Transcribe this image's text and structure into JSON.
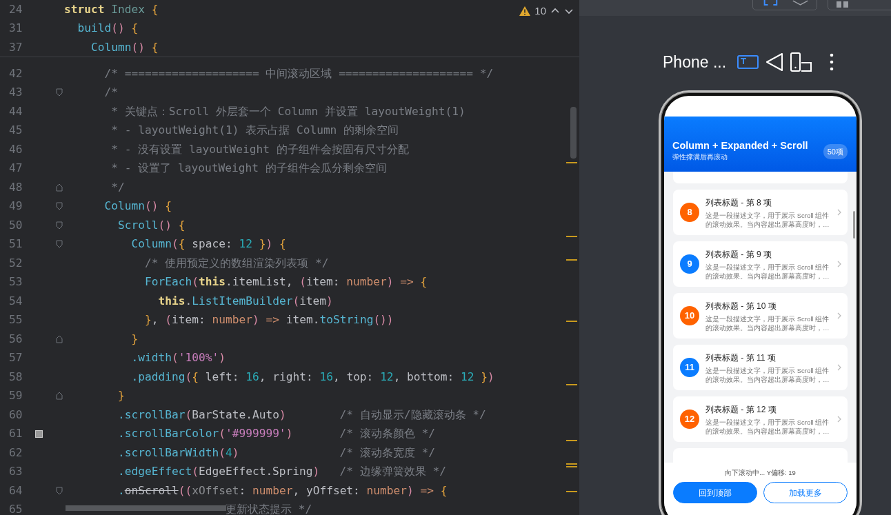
{
  "editor": {
    "warnings_count": "10",
    "sticky_lines": [
      {
        "number": "24",
        "segments": [
          {
            "kind": "kw",
            "text": "struct "
          },
          {
            "kind": "dim",
            "text": "Index "
          },
          {
            "kind": "br",
            "text": "{"
          }
        ]
      },
      {
        "number": "31",
        "segments": [
          {
            "kind": "fn",
            "text": "  build"
          },
          {
            "kind": "pa",
            "text": "() "
          },
          {
            "kind": "br",
            "text": "{"
          }
        ]
      },
      {
        "number": "37",
        "segments": [
          {
            "kind": "fn",
            "text": "    Column"
          },
          {
            "kind": "pa",
            "text": "() "
          },
          {
            "kind": "br",
            "text": "{"
          }
        ]
      }
    ],
    "lines": [
      {
        "number": "42",
        "fold_open": false,
        "fold_close": false,
        "segments": [
          {
            "kind": "c",
            "text": "      /* ==================== 中间滚动区域 ==================== */"
          }
        ]
      },
      {
        "number": "43",
        "fold_open": true,
        "fold_close": false,
        "segments": [
          {
            "kind": "c",
            "text": "      /*"
          }
        ]
      },
      {
        "number": "44",
        "fold_open": false,
        "fold_close": false,
        "segments": [
          {
            "kind": "c",
            "text": "       * 关键点：Scroll 外层套一个 Column 并设置 layoutWeight(1)"
          }
        ]
      },
      {
        "number": "45",
        "fold_open": false,
        "fold_close": false,
        "segments": [
          {
            "kind": "c",
            "text": "       * - layoutWeight(1) 表示占据 Column 的剩余空间"
          }
        ]
      },
      {
        "number": "46",
        "fold_open": false,
        "fold_close": false,
        "segments": [
          {
            "kind": "c",
            "text": "       * - 没有设置 layoutWeight 的子组件会按固有尺寸分配"
          }
        ]
      },
      {
        "number": "47",
        "fold_open": false,
        "fold_close": false,
        "segments": [
          {
            "kind": "c",
            "text": "       * - 设置了 layoutWeight 的子组件会瓜分剩余空间"
          }
        ]
      },
      {
        "number": "48",
        "fold_open": false,
        "fold_close": true,
        "segments": [
          {
            "kind": "c",
            "text": "       */"
          }
        ]
      },
      {
        "number": "49",
        "fold_open": true,
        "fold_close": false,
        "segments": [
          {
            "kind": "fn",
            "text": "      Column"
          },
          {
            "kind": "pa",
            "text": "() "
          },
          {
            "kind": "br",
            "text": "{"
          }
        ]
      },
      {
        "number": "50",
        "fold_open": true,
        "fold_close": false,
        "segments": [
          {
            "kind": "fn",
            "text": "        Scroll"
          },
          {
            "kind": "pa",
            "text": "() "
          },
          {
            "kind": "br",
            "text": "{"
          }
        ]
      },
      {
        "number": "51",
        "fold_open": true,
        "fold_close": false,
        "segments": [
          {
            "kind": "fn",
            "text": "          Column"
          },
          {
            "kind": "pa",
            "text": "("
          },
          {
            "kind": "br",
            "text": "{"
          },
          {
            "kind": "p",
            "text": " space: "
          },
          {
            "kind": "n",
            "text": "12 "
          },
          {
            "kind": "br",
            "text": "}"
          },
          {
            "kind": "pa",
            "text": ") "
          },
          {
            "kind": "br",
            "text": "{"
          }
        ]
      },
      {
        "number": "52",
        "fold_open": false,
        "fold_close": false,
        "segments": [
          {
            "kind": "c",
            "text": "            /* 使用预定义的数组渲染列表项 */"
          }
        ]
      },
      {
        "number": "53",
        "fold_open": false,
        "fold_close": false,
        "segments": [
          {
            "kind": "fn",
            "text": "            ForEach"
          },
          {
            "kind": "pa",
            "text": "("
          },
          {
            "kind": "kw",
            "text": "this"
          },
          {
            "kind": "p",
            "text": ".itemList, "
          },
          {
            "kind": "pa",
            "text": "("
          },
          {
            "kind": "p",
            "text": "item: "
          },
          {
            "kind": "t",
            "text": "number"
          },
          {
            "kind": "pa",
            "text": ") "
          },
          {
            "kind": "t",
            "text": "=> "
          },
          {
            "kind": "br",
            "text": "{"
          }
        ]
      },
      {
        "number": "54",
        "fold_open": false,
        "fold_close": false,
        "segments": [
          {
            "kind": "kw",
            "text": "              this"
          },
          {
            "kind": "p",
            "text": "."
          },
          {
            "kind": "fn",
            "text": "ListItemBuilder"
          },
          {
            "kind": "pa",
            "text": "("
          },
          {
            "kind": "p",
            "text": "item"
          },
          {
            "kind": "pa",
            "text": ")"
          }
        ]
      },
      {
        "number": "55",
        "fold_open": false,
        "fold_close": false,
        "segments": [
          {
            "kind": "br",
            "text": "            }"
          },
          {
            "kind": "p",
            "text": ", "
          },
          {
            "kind": "pa",
            "text": "("
          },
          {
            "kind": "p",
            "text": "item: "
          },
          {
            "kind": "t",
            "text": "number"
          },
          {
            "kind": "pa",
            "text": ") "
          },
          {
            "kind": "t",
            "text": "=>"
          },
          {
            "kind": "p",
            "text": " item."
          },
          {
            "kind": "fn",
            "text": "toString"
          },
          {
            "kind": "pa",
            "text": "())"
          }
        ]
      },
      {
        "number": "56",
        "fold_open": false,
        "fold_close": true,
        "segments": [
          {
            "kind": "br",
            "text": "          }"
          }
        ]
      },
      {
        "number": "57",
        "fold_open": false,
        "fold_close": false,
        "segments": [
          {
            "kind": "fn",
            "text": "          .width"
          },
          {
            "kind": "pa",
            "text": "("
          },
          {
            "kind": "s",
            "text": "'100%'"
          },
          {
            "kind": "pa",
            "text": ")"
          }
        ]
      },
      {
        "number": "58",
        "fold_open": false,
        "fold_close": false,
        "segments": [
          {
            "kind": "fn",
            "text": "          .padding"
          },
          {
            "kind": "pa",
            "text": "("
          },
          {
            "kind": "br",
            "text": "{"
          },
          {
            "kind": "p",
            "text": " left: "
          },
          {
            "kind": "n",
            "text": "16"
          },
          {
            "kind": "p",
            "text": ", right: "
          },
          {
            "kind": "n",
            "text": "16"
          },
          {
            "kind": "p",
            "text": ", top: "
          },
          {
            "kind": "n",
            "text": "12"
          },
          {
            "kind": "p",
            "text": ", bottom: "
          },
          {
            "kind": "n",
            "text": "12 "
          },
          {
            "kind": "br",
            "text": "}"
          },
          {
            "kind": "pa",
            "text": ")"
          }
        ]
      },
      {
        "number": "59",
        "fold_open": false,
        "fold_close": true,
        "segments": [
          {
            "kind": "br",
            "text": "        }"
          }
        ]
      },
      {
        "number": "60",
        "fold_open": false,
        "fold_close": false,
        "segments": [
          {
            "kind": "fn",
            "text": "        .scrollBar"
          },
          {
            "kind": "pa",
            "text": "("
          },
          {
            "kind": "p",
            "text": "BarState.Auto"
          },
          {
            "kind": "pa",
            "text": ")        "
          },
          {
            "kind": "c",
            "text": "/* 自动显示/隐藏滚动条 */"
          }
        ]
      },
      {
        "number": "61",
        "fold_open": false,
        "fold_close": false,
        "color": "#999999",
        "segments": [
          {
            "kind": "fn",
            "text": "        .scrollBarColor"
          },
          {
            "kind": "pa",
            "text": "("
          },
          {
            "kind": "s",
            "text": "'#999999'"
          },
          {
            "kind": "pa",
            "text": ")       "
          },
          {
            "kind": "c",
            "text": "/* 滚动条颜色 */"
          }
        ]
      },
      {
        "number": "62",
        "fold_open": false,
        "fold_close": false,
        "segments": [
          {
            "kind": "fn",
            "text": "        .scrollBarWidth"
          },
          {
            "kind": "pa",
            "text": "("
          },
          {
            "kind": "n",
            "text": "4"
          },
          {
            "kind": "pa",
            "text": ")               "
          },
          {
            "kind": "c",
            "text": "/* 滚动条宽度 */"
          }
        ]
      },
      {
        "number": "63",
        "fold_open": false,
        "fold_close": false,
        "segments": [
          {
            "kind": "fn",
            "text": "        .edgeEffect"
          },
          {
            "kind": "pa",
            "text": "("
          },
          {
            "kind": "p",
            "text": "EdgeEffect.Spring"
          },
          {
            "kind": "pa",
            "text": ")   "
          },
          {
            "kind": "c",
            "text": "/* 边缘弹簧效果 */"
          }
        ]
      },
      {
        "number": "64",
        "fold_open": true,
        "fold_close": false,
        "segments": [
          {
            "kind": "fn",
            "text": "        ."
          },
          {
            "kind": "x",
            "text": "onScroll"
          },
          {
            "kind": "pa",
            "text": "(("
          },
          {
            "kind": "dim2",
            "text": "xOffset"
          },
          {
            "kind": "p",
            "text": ": "
          },
          {
            "kind": "t",
            "text": "number"
          },
          {
            "kind": "p",
            "text": ", yOffset: "
          },
          {
            "kind": "t",
            "text": "number"
          },
          {
            "kind": "pa",
            "text": ") "
          },
          {
            "kind": "t",
            "text": "=> "
          },
          {
            "kind": "br",
            "text": "{"
          }
        ]
      },
      {
        "number": "65",
        "fold_open": false,
        "fold_close": false,
        "segments": [
          {
            "kind": "c",
            "text": "                        更新状态提示 */"
          }
        ]
      }
    ]
  },
  "preview": {
    "device_label": "Phone ...",
    "phone": {
      "header": {
        "title": "Column + Expanded + Scroll",
        "subtitle": "弹性撑满后再滚动",
        "badge": "50项"
      },
      "items": [
        {
          "number": "8",
          "title": "列表标题 - 第 8 项",
          "description": "这是一段描述文字，用于展示 Scroll 组件的滚动效果。当内容超出屏幕高度时，…",
          "color": "#ff6200"
        },
        {
          "number": "9",
          "title": "列表标题 - 第 9 项",
          "description": "这是一段描述文字，用于展示 Scroll 组件的滚动效果。当内容超出屏幕高度时，…",
          "color": "#0a7cff"
        },
        {
          "number": "10",
          "title": "列表标题 - 第 10 项",
          "description": "这是一段描述文字，用于展示 Scroll 组件的滚动效果。当内容超出屏幕高度时，…",
          "color": "#ff6200"
        },
        {
          "number": "11",
          "title": "列表标题 - 第 11 项",
          "description": "这是一段描述文字，用于展示 Scroll 组件的滚动效果。当内容超出屏幕高度时，…",
          "color": "#0a7cff"
        },
        {
          "number": "12",
          "title": "列表标题 - 第 12 项",
          "description": "这是一段描述文字，用于展示 Scroll 组件的滚动效果。当内容超出屏幕高度时，…",
          "color": "#ff6200"
        }
      ],
      "status": "向下滚动中... Y偏移: 19",
      "buttons": [
        {
          "label": "回到顶部",
          "kind": "primary"
        },
        {
          "label": "加载更多",
          "kind": "outline"
        }
      ]
    }
  }
}
